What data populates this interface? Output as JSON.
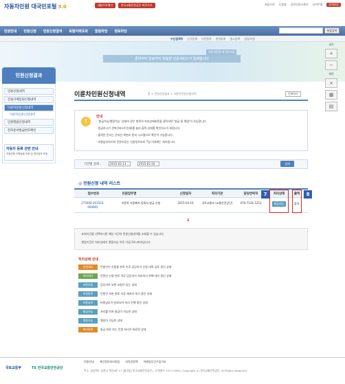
{
  "header": {
    "logo": "자동차민원 대국민포털",
    "logo_badge": "3.0",
    "top_buttons": [
      "새창으로열기",
      "한국교통안전공단 바로가기"
    ],
    "util_links": [
      "처음으로",
      "도움말",
      "공인인증서관리",
      "사이트맵"
    ],
    "util_red": "장애지원"
  },
  "nav": {
    "items": [
      "민원안내",
      "민원신청",
      "민원신청결과",
      "토탈이력조회",
      "알림마당",
      "정보마당"
    ],
    "search_button": "통합검색"
  },
  "subnav": {
    "current": "수신검색어",
    "links": [
      "신규등록",
      "이전등록",
      "변경등록",
      "말소등록",
      "압류/저당"
    ]
  },
  "banner": {
    "line": "준비부터 완료까지 맞춤형 민원서비스가 함께합니다",
    "title": "자동차민원 대국민포털"
  },
  "sidebar": {
    "title": "민원신청결과",
    "items": [
      {
        "label": "민원신청내역",
        "active": false
      },
      {
        "label": "건설기계민원신청내역",
        "active": false
      },
      {
        "label": "이륜차민원신청내역",
        "active": true
      },
      {
        "label": "이륜차민원신청내역",
        "sub": true
      },
      {
        "label": "민원열람신청내역",
        "active": false
      },
      {
        "label": "전자문서발급번호확인",
        "active": false
      }
    ],
    "promo_title": "자동차 등록 관련 안내",
    "promo_text": "지점민원 진행상황 조회 및 개인정보 보호"
  },
  "page": {
    "title": "이륜차민원신청내역",
    "breadcrumb": "홈 > 민원신청결과 > 이륜차민원신청내역",
    "print": "인쇄하기"
  },
  "notice": {
    "icon": "!",
    "head": "안내",
    "lines": [
      "· '발급가능/열람가능' 상태의 경우 항목의 처리상태버튼을 클릭하면 '발급 및 열람'이 가능합니다.",
      "· 발급하시기 전에 [테스트인쇄]를 눌러 출력 상태를 확인하시기 바랍니다.",
      "· 출력된 문서는 온라인 위변조 방지 시스템으로 확인이 가능합니다.",
      "· 비용납부하기의 민원서류는 신청일로부터 7일 이내에는 처리됩니다."
    ]
  },
  "search": {
    "label": "기간별 검색 :",
    "from": "2015-03-13",
    "to": "2015-03-16",
    "button": "검색"
  },
  "list": {
    "title": "민원신청 내역 리스트",
    "headers": [
      "접수번호",
      "민원업무명",
      "신청일자",
      "처리기관",
      "담당연락처",
      "처리상태",
      "출력"
    ],
    "rows": [
      {
        "receipt": "273000-201503-000005",
        "name": "이륜차 사용폐지 등록서 발급 신청",
        "date": "2015-03-16",
        "office": "국토교통부 (교통안전공단)",
        "phone": "070-7124-1251",
        "status": "발급가능",
        "print": "출력"
      }
    ],
    "markers": [
      "7",
      "8"
    ],
    "page": "1"
  },
  "info": {
    "lines": [
      "· 조회기간을 선택하시면 해당 기간의 민원신청내역을 조회할 수 있습니다.",
      "· 열람기간은 처리상태가 열람가능 이후 익일 24시까지입니다."
    ]
  },
  "legend": {
    "title": "처리상태 안내",
    "items": [
      {
        "tag": "신청대기",
        "color": "#e08a2a",
        "desc": "민원인이 신청을 완료 이후 담당자가 신청 내역 검토 중인 상태"
      },
      {
        "tag": "처리대기",
        "color": "#6aa84f",
        "desc": "민원인 신청 완료 이후 담당자가 처리하기 위해 대기 중인 상태"
      },
      {
        "tag": "보완요청",
        "color": "#5a9fc0",
        "desc": "담당자의 보완 요청이 있는 상태"
      },
      {
        "tag": "보완완료",
        "color": "#5a9fc0",
        "desc": "민원인 보완 완료 이후 재처리 대기 중인 상태"
      },
      {
        "tag": "비용납부",
        "color": "#5a9fc0",
        "desc": "비용납부가 완료되어 처리 진행 중인 상태"
      },
      {
        "tag": "발급가능",
        "color": "#5a9fc0",
        "desc": "처리를 마쳐 발급이 가능한 상태"
      },
      {
        "tag": "열람가능",
        "color": "#5a9fc0",
        "desc": "열람이 가능한 상태"
      },
      {
        "tag": "처리완료",
        "color": "#e08a2a",
        "desc": "발급 완료 또는 민원 처리가 완료된 상태"
      }
    ]
  },
  "right_tools": {
    "font_label": "글자",
    "zoom_label": "화면",
    "boxes": [
      "+",
      "−",
      "×",
      "▦",
      "▤"
    ]
  },
  "footer": {
    "logo1": "국토교통부",
    "logo2": "TS 한국교통안전공단",
    "links": [
      "이용안내",
      "개인정보처리방침",
      "저작권정책",
      "이메일무단수집거부"
    ],
    "text": "주소: 경상북도 김천시 혁신6로 17 (율곡동) 한국교통안전공단 | 고객센터: 1577-0990 | Copyright (c) 한국교통안전공단. All Rights Reserved."
  }
}
